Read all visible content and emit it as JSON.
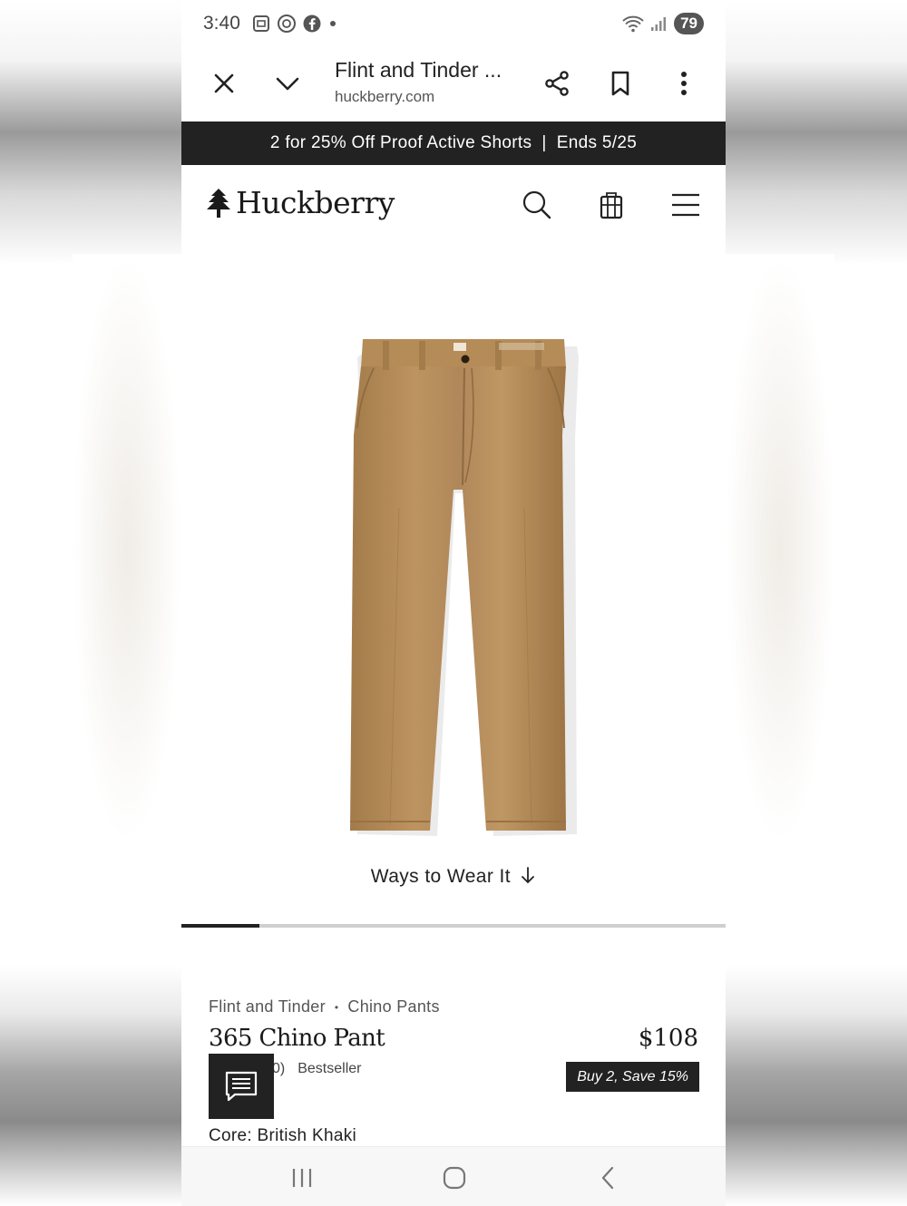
{
  "status_bar": {
    "time": "3:40",
    "battery": "79",
    "left_icons": [
      "screenshot-icon",
      "threads-icon",
      "facebook-icon",
      "dot-icon"
    ],
    "right_icons": [
      "wifi-icon",
      "signal-icon",
      "battery-icon"
    ]
  },
  "browser": {
    "tab_title": "Flint and Tinder ...",
    "url": "huckberry.com",
    "icons": [
      "close-icon",
      "chevron-down-icon",
      "share-icon",
      "bookmark-icon",
      "more-vert-icon"
    ]
  },
  "promo_banner": {
    "text": "2 for 25% Off Proof Active Shorts  |  Ends 5/25"
  },
  "header": {
    "logo_text": "Huckberry",
    "icons": [
      "tree-logo-icon",
      "search-icon",
      "cart-icon",
      "menu-icon"
    ]
  },
  "gallery": {
    "image_alt_icon": "pants-image",
    "ways_to_wear_label": "Ways to Wear It",
    "progress": 0.143
  },
  "product": {
    "brand": "Flint and Tinder",
    "separator": "•",
    "category": "Chino Pants",
    "name": "365 Chino Pant",
    "price": "$108",
    "rating_fragment": "0)",
    "badge": "Bestseller",
    "promo_badge": "Buy 2, Save 15%",
    "color_label": "Core: British Khaki"
  },
  "colors": {
    "dark": "#222222",
    "khaki": "#b38a56"
  },
  "nav_bar": {
    "icons": [
      "recent-apps-icon",
      "home-icon",
      "back-icon"
    ]
  }
}
